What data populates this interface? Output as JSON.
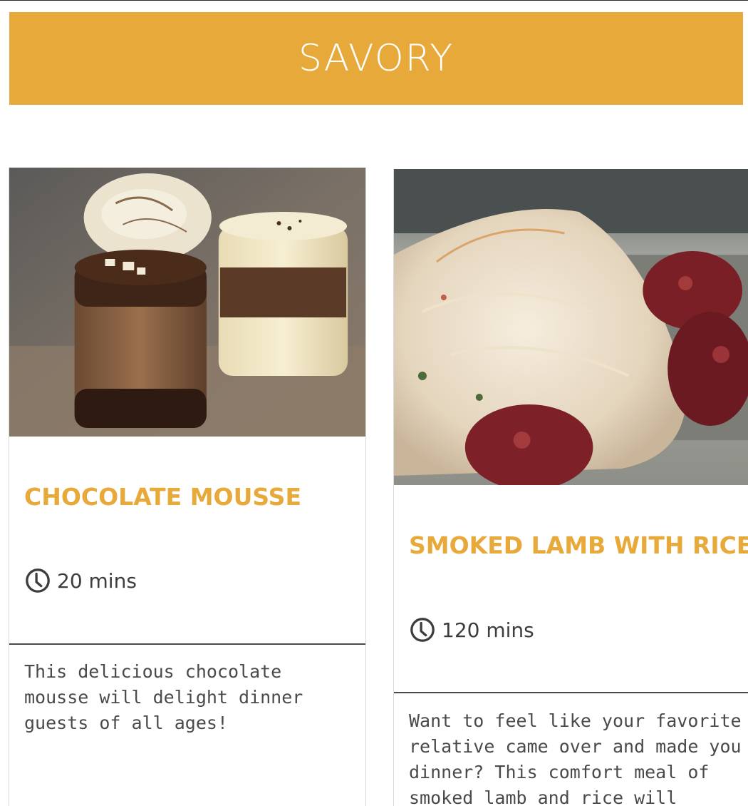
{
  "banner": {
    "title": "SAVORY",
    "color": "#E8A93B"
  },
  "recipes": [
    {
      "title": "CHOCOLATE MOUSSE",
      "time": "20 mins",
      "time_icon": "clock-icon",
      "description": "This delicious chocolate mousse will delight dinner guests of all ages!",
      "image": "chocolate-mousse-photo"
    },
    {
      "title": "SMOKED LAMB WITH RICE",
      "time": "120 mins",
      "time_icon": "clock-icon",
      "description": "Want to feel like your favorite relative came over and made you dinner? This comfort meal of smoked lamb and rice will quickly",
      "image": "smoked-lamb-rice-photo"
    }
  ]
}
